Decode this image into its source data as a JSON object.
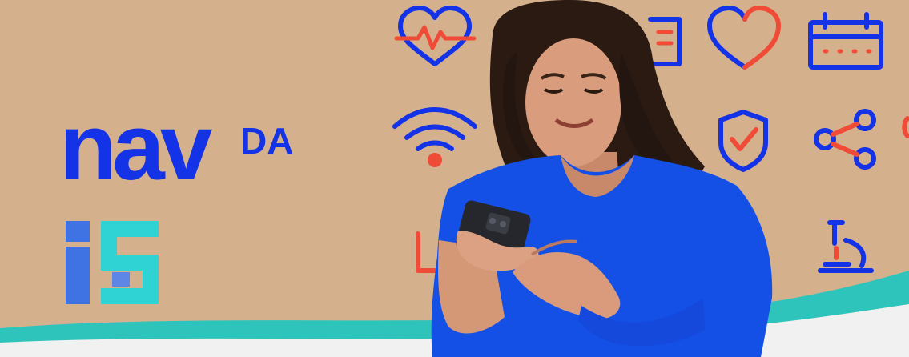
{
  "brand": {
    "wordmark": "nav",
    "wordmark_suffix": "DA",
    "primary_color": "#1432e6",
    "accent_color": "#ef4b37",
    "teal_color": "#2ec4bc",
    "background_color": "#d5b08c"
  },
  "icons": [
    "heart-pulse-icon",
    "document-icon",
    "heart-icon",
    "calendar-icon",
    "wifi-icon",
    "shield-check-icon",
    "share-icon",
    "microscope-icon",
    "device-icon"
  ],
  "photo": {
    "subject": "woman-using-smartphone"
  }
}
